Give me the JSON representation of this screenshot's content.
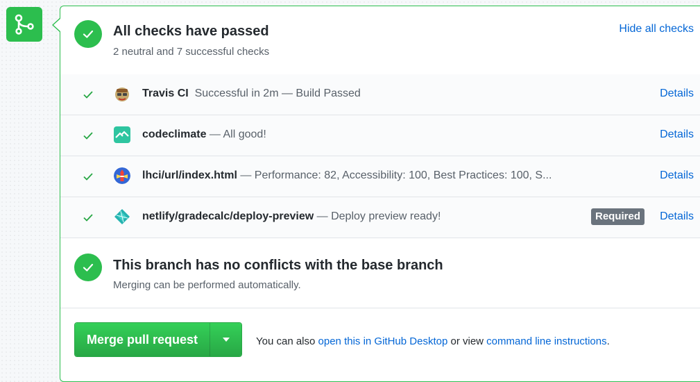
{
  "merge_status_icon": "git-merge-icon",
  "checks_summary": {
    "title": "All checks have passed",
    "subtitle": "2 neutral and 7 successful checks",
    "hide_link": "Hide all checks",
    "icon": "check-circle-icon"
  },
  "checks": [
    {
      "name": "Travis CI",
      "separator": "  ",
      "description": "Successful in 2m — Build Passed",
      "details": "Details",
      "avatar": "travis-ci-icon",
      "required": ""
    },
    {
      "name": "codeclimate",
      "separator": " — ",
      "description": "All good!",
      "details": "Details",
      "avatar": "codeclimate-icon",
      "required": ""
    },
    {
      "name": "lhci/url/index.html",
      "separator": " — ",
      "description": "Performance: 82, Accessibility: 100, Best Practices: 100, S...",
      "details": "Details",
      "avatar": "lighthouse-icon",
      "required": ""
    },
    {
      "name": "netlify/gradecalc/deploy-preview",
      "separator": " — ",
      "description": "Deploy preview ready!",
      "details": "Details",
      "avatar": "netlify-icon",
      "required": "Required"
    }
  ],
  "conflicts": {
    "title": "This branch has no conflicts with the base branch",
    "subtitle": "Merging can be performed automatically.",
    "icon": "check-circle-icon"
  },
  "merge": {
    "button_label": "Merge pull request",
    "caret_icon": "caret-down-icon",
    "prefix": "You can also ",
    "desktop_link": "open this in GitHub Desktop",
    "middle": " or view ",
    "cli_link": "command line instructions",
    "suffix": "."
  },
  "colors": {
    "success_green": "#2cbe4e",
    "link_blue": "#0366d6",
    "badge_gray": "#6a737d"
  }
}
